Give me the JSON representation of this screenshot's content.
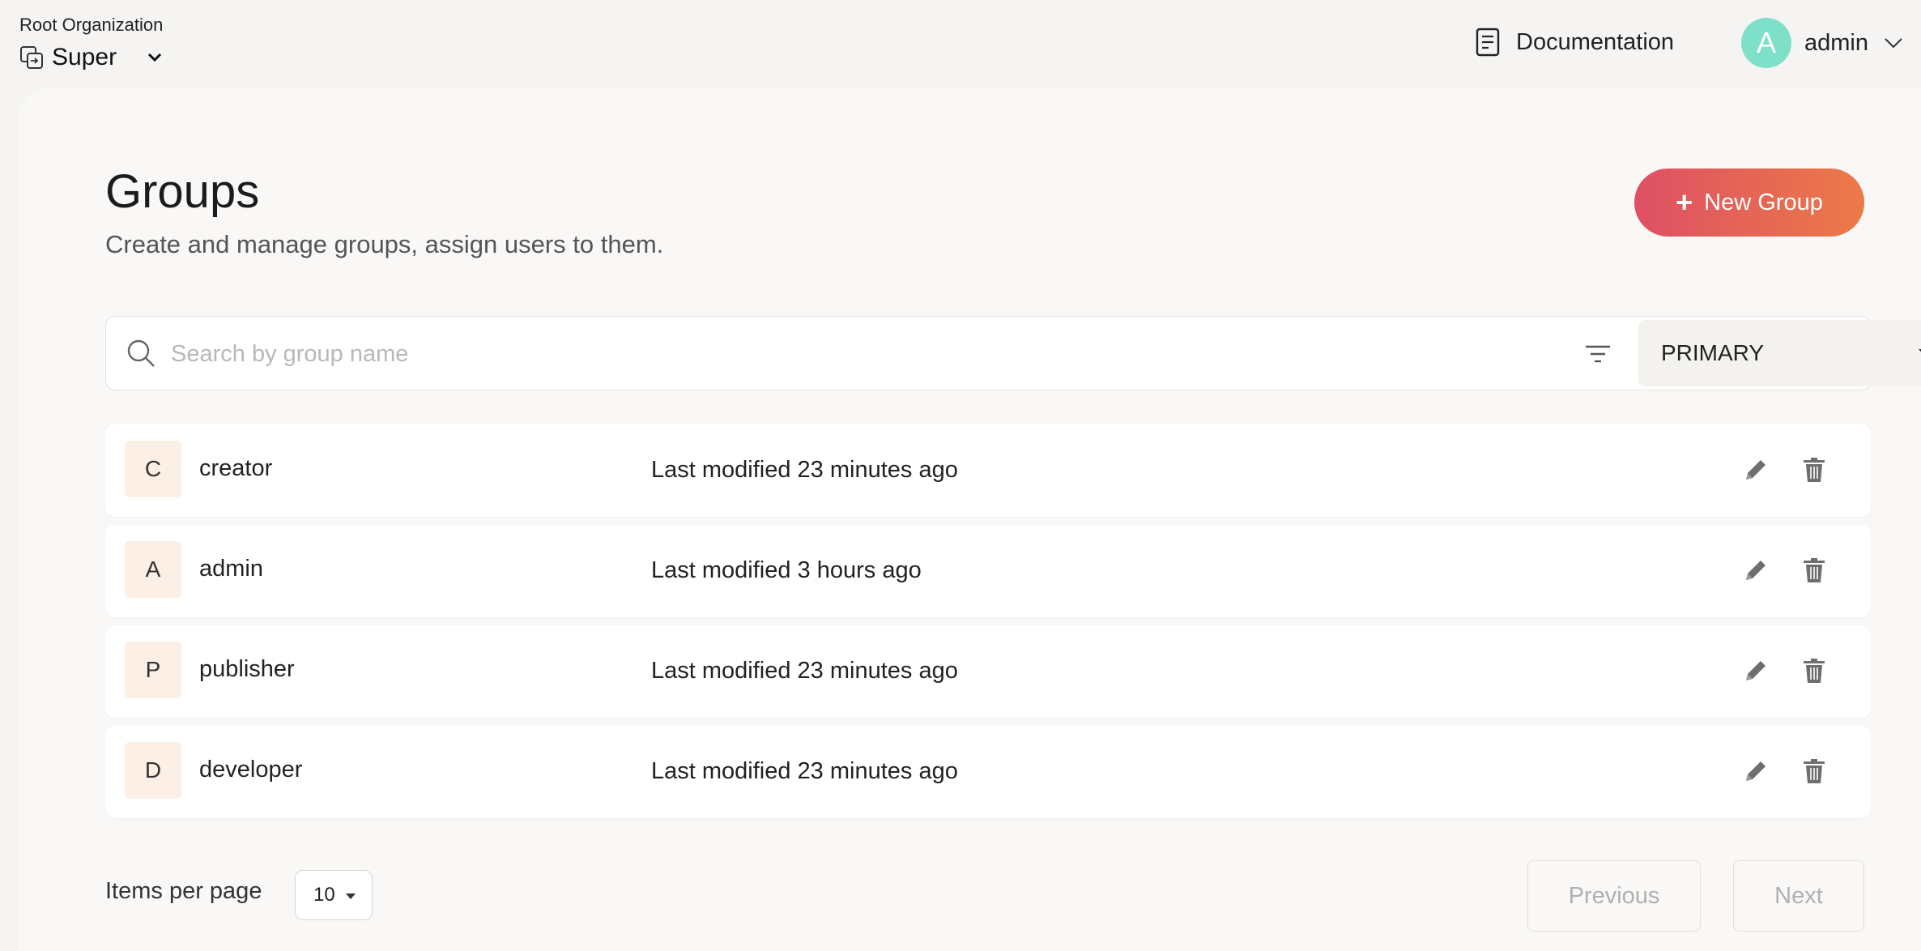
{
  "header": {
    "org_label": "Root Organization",
    "org_name": "Super",
    "documentation_label": "Documentation",
    "user": {
      "initial": "A",
      "name": "admin"
    }
  },
  "page": {
    "title": "Groups",
    "subtitle": "Create and manage groups, assign users to them.",
    "new_group_label": "New Group"
  },
  "search": {
    "placeholder": "Search by group name",
    "userstore": "PRIMARY"
  },
  "groups": [
    {
      "initial": "C",
      "name": "creator",
      "modified": "Last modified 23 minutes ago"
    },
    {
      "initial": "A",
      "name": "admin",
      "modified": "Last modified 3 hours ago"
    },
    {
      "initial": "P",
      "name": "publisher",
      "modified": "Last modified 23 minutes ago"
    },
    {
      "initial": "D",
      "name": "developer",
      "modified": "Last modified 23 minutes ago"
    }
  ],
  "pagination": {
    "items_per_page_label": "Items per page",
    "items_per_page": "10",
    "previous_label": "Previous",
    "next_label": "Next"
  },
  "colors": {
    "accent_start": "#de5065",
    "accent_end": "#ec7a47",
    "avatar": "#7ee0c8",
    "group_avatar_bg": "#fcefe5"
  }
}
